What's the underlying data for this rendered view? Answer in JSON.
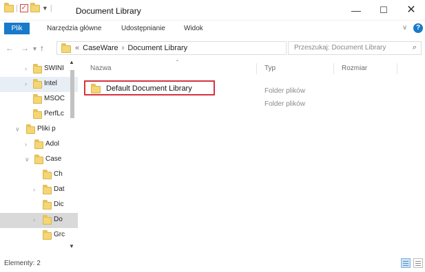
{
  "window": {
    "title": "Document Library",
    "controls": {
      "minimize": "—",
      "maximize": "☐",
      "close": "✕"
    }
  },
  "ribbon": {
    "tabs": [
      "Plik",
      "Narzędzia główne",
      "Udostępnianie",
      "Widok"
    ],
    "help": "?"
  },
  "address": {
    "ellipsis": "«",
    "crumbs": [
      "CaseWare",
      "Document Library"
    ],
    "separator": "›"
  },
  "search": {
    "placeholder": "Przeszukaj: Document Library"
  },
  "tree": {
    "items": [
      {
        "label": "SWINI",
        "expand": "›"
      },
      {
        "label": "Intel",
        "expand": "›"
      },
      {
        "label": "MSOC",
        "expand": ""
      },
      {
        "label": "PerfLc",
        "expand": ""
      },
      {
        "label": "Pliki p",
        "expand": "∨"
      },
      {
        "label": "Adol",
        "expand": "›"
      },
      {
        "label": "Case",
        "expand": "∨"
      },
      {
        "label": "Ch",
        "expand": ""
      },
      {
        "label": "Dat",
        "expand": "›"
      },
      {
        "label": "Dic",
        "expand": ""
      },
      {
        "label": "Do",
        "expand": "›"
      },
      {
        "label": "Grc",
        "expand": ""
      }
    ]
  },
  "columns": {
    "name": "Nazwa",
    "type": "Typ",
    "size": "Rozmiar"
  },
  "files": [
    {
      "name": "Default Document Library",
      "type": "Folder plików"
    },
    {
      "name": "",
      "type": "Folder plików"
    }
  ],
  "status": {
    "text": "Elementy: 2"
  },
  "colors": {
    "accent": "#1979ca",
    "highlight_border": "#d4323c",
    "folder": "#f4d674"
  }
}
